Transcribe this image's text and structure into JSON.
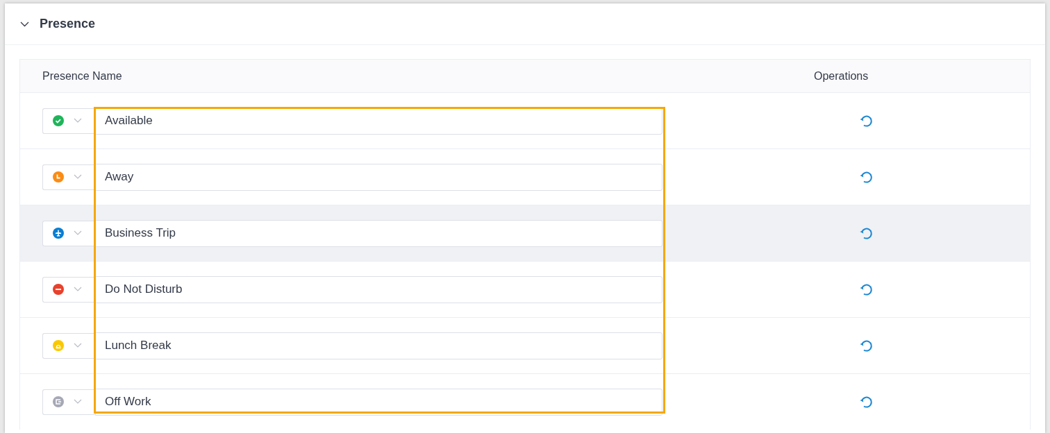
{
  "section": {
    "title": "Presence",
    "expanded": true
  },
  "table": {
    "columns": [
      "Presence Name",
      "Operations"
    ],
    "rows": [
      {
        "kind": "check",
        "color": "#1fb45a",
        "value": "Available",
        "highlighted": false
      },
      {
        "kind": "clock",
        "color": "#fa8c16",
        "value": "Away",
        "highlighted": false
      },
      {
        "kind": "plane",
        "color": "#0a7ed2",
        "value": "Business Trip",
        "highlighted": true
      },
      {
        "kind": "minus",
        "color": "#e8412c",
        "value": "Do Not Disturb",
        "highlighted": false
      },
      {
        "kind": "bell",
        "color": "#fac800",
        "value": "Lunch Break",
        "highlighted": false
      },
      {
        "kind": "exit",
        "color": "#a6a8b5",
        "value": "Off Work",
        "highlighted": false
      }
    ]
  },
  "annotation": {
    "shown": true,
    "color": "#f5a800"
  }
}
